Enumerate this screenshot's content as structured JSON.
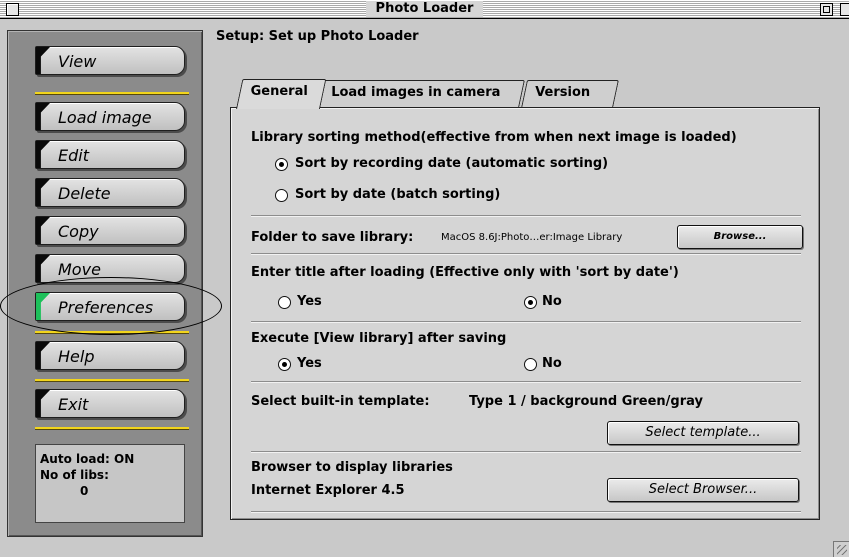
{
  "window": {
    "title": "Photo Loader"
  },
  "sidebar": {
    "buttons": [
      {
        "label": "View"
      },
      {
        "label": "Load image"
      },
      {
        "label": "Edit"
      },
      {
        "label": "Delete"
      },
      {
        "label": "Copy"
      },
      {
        "label": "Move"
      },
      {
        "label": "Preferences"
      },
      {
        "label": "Help"
      },
      {
        "label": "Exit"
      }
    ],
    "status": {
      "auto_load": "Auto load:  ON",
      "libs_label": "No of libs:",
      "libs_value": "0"
    }
  },
  "main": {
    "setup_label": "Setup: Set up Photo Loader",
    "tabs": [
      {
        "label": "General",
        "selected": true
      },
      {
        "label": "Load images in camera",
        "selected": false
      },
      {
        "label": "Version",
        "selected": false
      }
    ]
  },
  "general": {
    "sorting": {
      "heading": "Library sorting method(effective from when next image is loaded)",
      "option_recording": "Sort by recording date (automatic sorting)",
      "option_date": "Sort by date (batch sorting)",
      "selected": "recording"
    },
    "folder": {
      "label": "Folder to save library:",
      "path": "MacOS 8.6J:Photo…er:Image Library",
      "browse": "Browse..."
    },
    "title_entry": {
      "heading": "Enter title after loading (Effective only with 'sort by date')",
      "yes": "Yes",
      "no": "No",
      "selected": "no"
    },
    "execute_view": {
      "heading": "Execute [View library] after saving",
      "yes": "Yes",
      "no": "No",
      "selected": "yes"
    },
    "template": {
      "label": "Select built-in template:",
      "value": "Type 1 / background Green/gray",
      "button": "Select template..."
    },
    "browser": {
      "label": "Browser to display libraries",
      "value": "Internet Explorer 4.5",
      "button": "Select Browser..."
    }
  },
  "colors": {
    "sidebar_bg": "#8b8b8b",
    "separator": "#f2d51c",
    "active_flag": "#1dc05a"
  }
}
